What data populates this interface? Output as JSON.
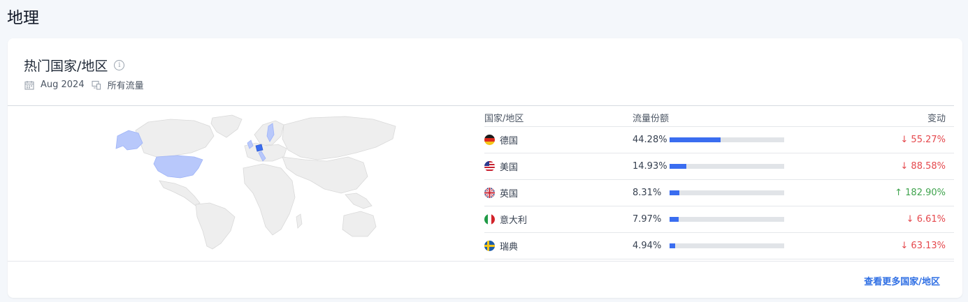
{
  "page": {
    "title": "地理"
  },
  "card": {
    "title": "热门国家/地区",
    "date": "Aug 2024",
    "traffic": "所有流量",
    "more_link": "查看更多国家/地区"
  },
  "table": {
    "headers": {
      "country": "国家/地区",
      "share": "流量份额",
      "change": "变动"
    },
    "rows": [
      {
        "country": "德国",
        "flag": "de",
        "share": "44.28%",
        "share_value": 44.28,
        "change": "55.27%",
        "direction": "down"
      },
      {
        "country": "美国",
        "flag": "us",
        "share": "14.93%",
        "share_value": 14.93,
        "change": "88.58%",
        "direction": "down"
      },
      {
        "country": "英国",
        "flag": "gb",
        "share": "8.31%",
        "share_value": 8.31,
        "change": "182.90%",
        "direction": "up"
      },
      {
        "country": "意大利",
        "flag": "it",
        "share": "7.97%",
        "share_value": 7.97,
        "change": "6.61%",
        "direction": "down"
      },
      {
        "country": "瑞典",
        "flag": "se",
        "share": "4.94%",
        "share_value": 4.94,
        "change": "63.13%",
        "direction": "down"
      }
    ]
  },
  "colors": {
    "accent": "#3a6df0",
    "down": "#e5484d",
    "up": "#3fa34d",
    "map_highlight": "#b8c8fb",
    "map_strong": "#3a6df0"
  }
}
